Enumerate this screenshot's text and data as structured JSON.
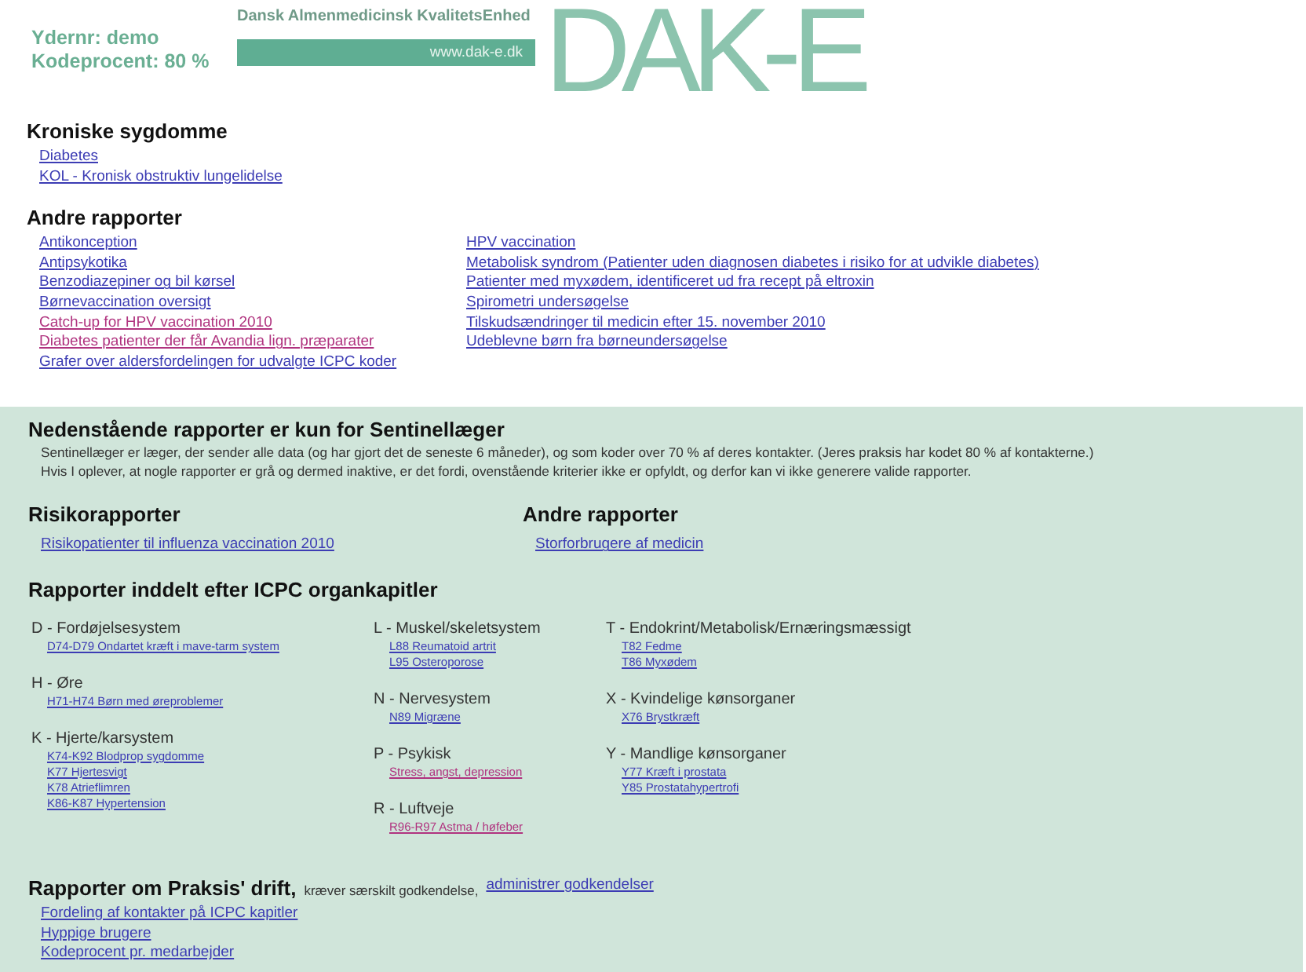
{
  "header": {
    "ydernr": "Ydernr: demo",
    "kodeprocent": "Kodeprocent: 80 %"
  },
  "banner": {
    "title": "Dansk Almenmedicinsk KvalitetsEnhed",
    "url": "www.dak-e.dk",
    "logo": "DAK-E"
  },
  "sections": [
    {
      "title": "Kroniske sygdomme",
      "columns": [
        [
          {
            "label": "Diabetes",
            "visited": false
          },
          {
            "label": "KOL - Kronisk obstruktiv lungelidelse",
            "visited": false
          }
        ]
      ]
    },
    {
      "title": "Andre rapporter",
      "columns": [
        [
          {
            "label": "Antikonception",
            "visited": false
          },
          {
            "label": "Antipsykotika",
            "visited": false
          },
          {
            "label": "Benzodiazepiner og bil kørsel",
            "visited": false
          },
          {
            "label": "Børnevaccination oversigt",
            "visited": false
          },
          {
            "label": "Catch-up for HPV vaccination 2010",
            "visited": true
          },
          {
            "label": "Diabetes patienter der får Avandia lign. præparater",
            "visited": true
          },
          {
            "label": "Grafer over aldersfordelingen for udvalgte ICPC koder",
            "visited": false
          }
        ],
        [
          {
            "label": "HPV vaccination",
            "visited": false
          },
          {
            "label": "Metabolisk syndrom (Patienter uden diagnosen diabetes i risiko for at udvikle diabetes)",
            "visited": false
          },
          {
            "label": "Patienter med myxødem, identificeret ud fra recept på eltroxin",
            "visited": false
          },
          {
            "label": "Spirometri undersøgelse",
            "visited": false
          },
          {
            "label": "Tilskudsændringer til medicin efter 15. november 2010",
            "visited": false
          },
          {
            "label": "Udeblevne børn fra børneundersøgelse",
            "visited": false
          }
        ]
      ]
    }
  ],
  "sentinel": {
    "title": "Nedenstående rapporter er kun for Sentinellæger",
    "notes": [
      "Sentinellæger er læger, der sender alle data (og har gjort det de seneste 6 måneder), og som koder over 70 % af deres kontakter. (Jeres praksis har kodet 80 % af kontakterne.)",
      "Hvis I oplever, at nogle rapporter er grå og dermed inaktive, er det fordi, ovenstående kriterier ikke er opfyldt, og derfor kan vi ikke generere valide rapporter."
    ],
    "columns": [
      {
        "title": "Risikorapporter",
        "links": [
          {
            "label": "Risikopatienter til influenza vaccination 2010",
            "visited": false
          }
        ]
      },
      {
        "title": "Andre rapporter",
        "links": [
          {
            "label": "Storforbrugere af medicin",
            "visited": false
          }
        ]
      }
    ],
    "icpc": {
      "title": "Rapporter inddelt efter ICPC organkapitler",
      "columns": [
        [
          {
            "group": "D - Fordøjelsesystem",
            "links": [
              {
                "label": "D74-D79 Ondartet kræft i mave-tarm system",
                "visited": false
              }
            ]
          },
          {
            "group": "H - Øre",
            "links": [
              {
                "label": "H71-H74 Børn med øreproblemer",
                "visited": false
              }
            ]
          },
          {
            "group": "K - Hjerte/karsystem",
            "links": [
              {
                "label": "K74-K92 Blodprop sygdomme",
                "visited": false
              },
              {
                "label": "K77 Hjertesvigt",
                "visited": false
              },
              {
                "label": "K78 Atrieflimren",
                "visited": false
              },
              {
                "label": "K86-K87 Hypertension",
                "visited": false
              }
            ]
          }
        ],
        [
          {
            "group": "L - Muskel/skeletsystem",
            "links": [
              {
                "label": "L88 Reumatoid artrit",
                "visited": false
              },
              {
                "label": "L95 Osteroporose",
                "visited": false
              }
            ]
          },
          {
            "group": "N - Nervesystem",
            "links": [
              {
                "label": "N89 Migræne",
                "visited": false
              }
            ]
          },
          {
            "group": "P - Psykisk",
            "links": [
              {
                "label": "Stress, angst, depression",
                "visited": true
              }
            ]
          },
          {
            "group": "R - Luftveje",
            "links": [
              {
                "label": "R96-R97 Astma / høfeber",
                "visited": true
              }
            ]
          }
        ],
        [
          {
            "group": "T - Endokrint/Metabolisk/Ernæringsmæssigt",
            "links": [
              {
                "label": "T82 Fedme",
                "visited": false
              },
              {
                "label": "T86 Myxødem",
                "visited": false
              }
            ]
          },
          {
            "group": "X - Kvindelige kønsorganer",
            "links": [
              {
                "label": "X76 Brystkræft",
                "visited": false
              }
            ]
          },
          {
            "group": "Y - Mandlige kønsorganer",
            "links": [
              {
                "label": "Y77 Kræft i prostata",
                "visited": false
              },
              {
                "label": "Y85 Prostatahypertrofi",
                "visited": false
              }
            ]
          }
        ]
      ]
    },
    "praksis": {
      "title": "Rapporter om Praksis' drift,",
      "note": "kræver særskilt godkendelse,",
      "admin_link": "administrer godkendelser",
      "links": [
        {
          "label": "Fordeling af kontakter på ICPC kapitler",
          "visited": false
        },
        {
          "label": "Hyppige brugere",
          "visited": false
        },
        {
          "label": "Kodeprocent pr. medarbejder",
          "visited": false
        }
      ]
    }
  }
}
